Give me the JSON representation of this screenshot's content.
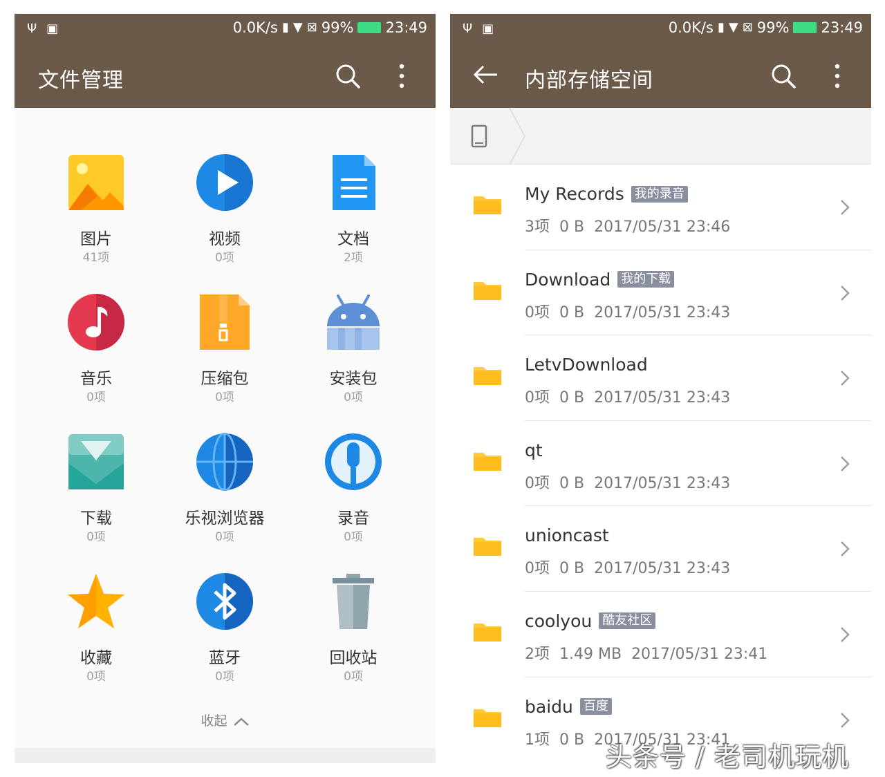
{
  "status_bar": {
    "speed": "0.0K/s",
    "battery": "99%",
    "time": "23:49"
  },
  "left": {
    "title": "文件管理",
    "categories": [
      {
        "label": "图片",
        "count": "41项",
        "icon": "image-icon"
      },
      {
        "label": "视频",
        "count": "0项",
        "icon": "video-play-icon"
      },
      {
        "label": "文档",
        "count": "2项",
        "icon": "document-icon"
      },
      {
        "label": "音乐",
        "count": "0项",
        "icon": "music-note-icon"
      },
      {
        "label": "压缩包",
        "count": "0项",
        "icon": "archive-zip-icon"
      },
      {
        "label": "安装包",
        "count": "0项",
        "icon": "android-apk-icon"
      },
      {
        "label": "下载",
        "count": "0项",
        "icon": "download-icon"
      },
      {
        "label": "乐视浏览器",
        "count": "0项",
        "icon": "browser-globe-icon"
      },
      {
        "label": "录音",
        "count": "0项",
        "icon": "microphone-icon"
      },
      {
        "label": "收藏",
        "count": "0项",
        "icon": "star-icon"
      },
      {
        "label": "蓝牙",
        "count": "0项",
        "icon": "bluetooth-icon"
      },
      {
        "label": "回收站",
        "count": "0项",
        "icon": "trash-icon"
      }
    ],
    "collapse_label": "收起"
  },
  "right": {
    "title": "内部存储空间",
    "folders": [
      {
        "name": "My Records",
        "tag": "我的录音",
        "items": "3项",
        "size": "0 B",
        "date": "2017/05/31 23:46"
      },
      {
        "name": "Download",
        "tag": "我的下载",
        "items": "0项",
        "size": "0 B",
        "date": "2017/05/31 23:43"
      },
      {
        "name": "LetvDownload",
        "tag": "",
        "items": "0项",
        "size": "0 B",
        "date": "2017/05/31 23:43"
      },
      {
        "name": "qt",
        "tag": "",
        "items": "0项",
        "size": "0 B",
        "date": "2017/05/31 23:43"
      },
      {
        "name": "unioncast",
        "tag": "",
        "items": "0项",
        "size": "0 B",
        "date": "2017/05/31 23:43"
      },
      {
        "name": "coolyou",
        "tag": "酷友社区",
        "items": "2项",
        "size": "1.49 MB",
        "date": "2017/05/31 23:41"
      },
      {
        "name": "baidu",
        "tag": "百度",
        "items": "1项",
        "size": "0 B",
        "date": "2017/05/31 23:41"
      }
    ]
  },
  "watermark": "头条号 / 老司机玩机",
  "colors": {
    "toolbar": "#6b594a",
    "folder": "#ffc83d",
    "tag": "#8a8fa0"
  }
}
